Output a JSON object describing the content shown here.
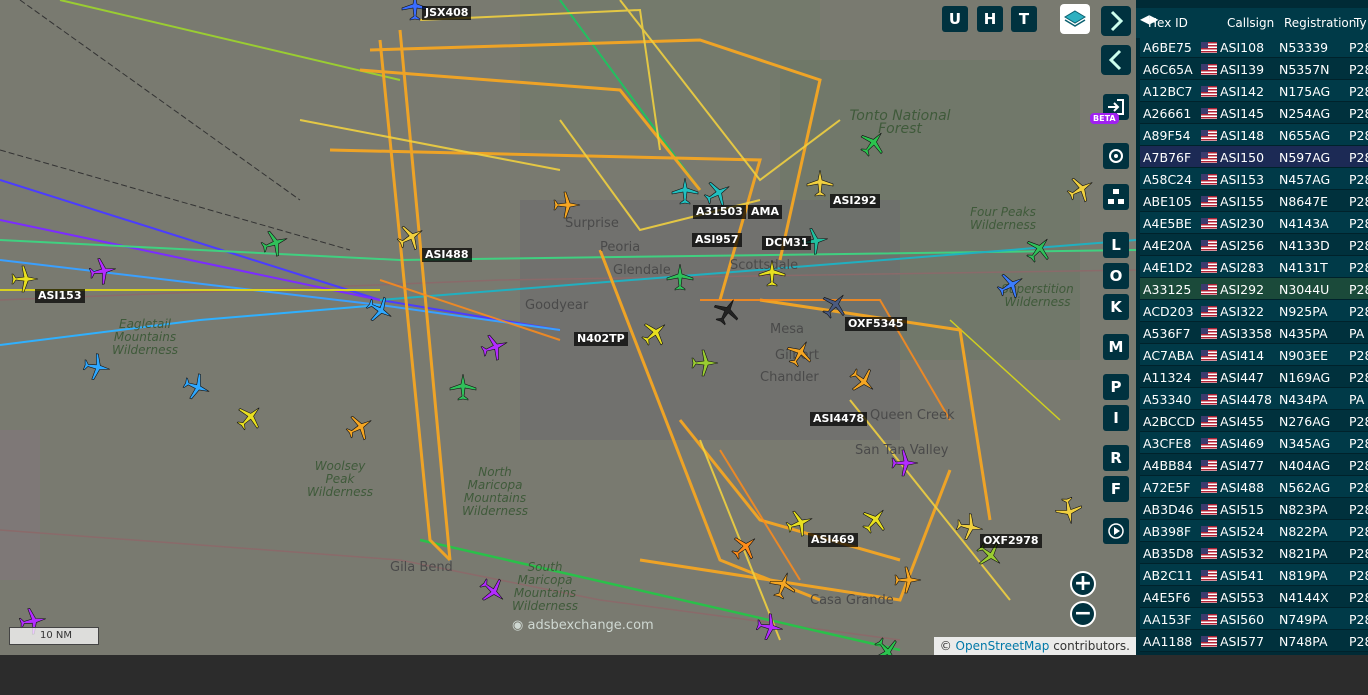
{
  "map": {
    "places": [
      {
        "name": "Tonto National Forest",
        "style": "green"
      },
      {
        "name": "Four Peaks Wilderness",
        "style": "green"
      },
      {
        "name": "Superstition Wilderness",
        "style": "green"
      },
      {
        "name": "Eagletail Mountains Wilderness",
        "style": "green"
      },
      {
        "name": "Woolsey Peak Wilderness",
        "style": "green"
      },
      {
        "name": "North Maricopa Mountains Wilderness",
        "style": "green"
      },
      {
        "name": "South Maricopa Mountains Wilderness",
        "style": "green"
      },
      {
        "name": "Surprise",
        "style": "city"
      },
      {
        "name": "Peoria",
        "style": "city"
      },
      {
        "name": "Glendale",
        "style": "city"
      },
      {
        "name": "Scottsdale",
        "style": "city"
      },
      {
        "name": "Goodyear",
        "style": "city"
      },
      {
        "name": "Mesa",
        "style": "city"
      },
      {
        "name": "Gilbert",
        "style": "city"
      },
      {
        "name": "Chandler",
        "style": "city"
      },
      {
        "name": "Queen Creek",
        "style": "city"
      },
      {
        "name": "San Tan Valley",
        "style": "city"
      },
      {
        "name": "Gila Bend",
        "style": "city"
      },
      {
        "name": "Casa Grande",
        "style": "city"
      }
    ],
    "labels": [
      "JSX408",
      "ASI292",
      "ASI488",
      "ASI153",
      "ASI957",
      "DCM31",
      "N402TP",
      "OXF5345",
      "ASI4478",
      "ASI469",
      "OXF2978",
      "A31503",
      "AMA"
    ],
    "watermark": "adsbexchange.com",
    "scale_text": "10 NM",
    "credit_prefix": "©",
    "credit_link": "OpenStreetMap",
    "credit_suffix": "contributors."
  },
  "toolbar": {
    "top_buttons": [
      "U",
      "H",
      "T"
    ],
    "side_buttons": [
      "L",
      "O",
      "K",
      "M",
      "P",
      "I",
      "R",
      "F"
    ],
    "beta_label": "BETA",
    "zoom_in": "+",
    "zoom_out": "−"
  },
  "table": {
    "columns": [
      "Hex ID",
      "Callsign",
      "Registration",
      "Ty"
    ],
    "rows": [
      {
        "hex": "A6BE75",
        "callsign": "ASI108",
        "reg": "N53339",
        "type": "P28"
      },
      {
        "hex": "A6C65A",
        "callsign": "ASI139",
        "reg": "N5357N",
        "type": "P28"
      },
      {
        "hex": "A12BC7",
        "callsign": "ASI142",
        "reg": "N175AG",
        "type": "P28"
      },
      {
        "hex": "A26661",
        "callsign": "ASI145",
        "reg": "N254AG",
        "type": "P28"
      },
      {
        "hex": "A89F54",
        "callsign": "ASI148",
        "reg": "N655AG",
        "type": "P28"
      },
      {
        "hex": "A7B76F",
        "callsign": "ASI150",
        "reg": "N597AG",
        "type": "P28"
      },
      {
        "hex": "A58C24",
        "callsign": "ASI153",
        "reg": "N457AG",
        "type": "P28"
      },
      {
        "hex": "ABE105",
        "callsign": "ASI155",
        "reg": "N8647E",
        "type": "P28"
      },
      {
        "hex": "A4E5BE",
        "callsign": "ASI230",
        "reg": "N4143A",
        "type": "P28"
      },
      {
        "hex": "A4E20A",
        "callsign": "ASI256",
        "reg": "N4133D",
        "type": "P28"
      },
      {
        "hex": "A4E1D2",
        "callsign": "ASI283",
        "reg": "N4131T",
        "type": "P28"
      },
      {
        "hex": "A33125",
        "callsign": "ASI292",
        "reg": "N3044U",
        "type": "P28"
      },
      {
        "hex": "ACD203",
        "callsign": "ASI322",
        "reg": "N925PA",
        "type": "P28"
      },
      {
        "hex": "A536F7",
        "callsign": "ASI3358",
        "reg": "N435PA",
        "type": "PA"
      },
      {
        "hex": "AC7ABA",
        "callsign": "ASI414",
        "reg": "N903EE",
        "type": "P28"
      },
      {
        "hex": "A11324",
        "callsign": "ASI447",
        "reg": "N169AG",
        "type": "P28"
      },
      {
        "hex": "A53340",
        "callsign": "ASI4478",
        "reg": "N434PA",
        "type": "PA"
      },
      {
        "hex": "A2BCCD",
        "callsign": "ASI455",
        "reg": "N276AG",
        "type": "P28"
      },
      {
        "hex": "A3CFE8",
        "callsign": "ASI469",
        "reg": "N345AG",
        "type": "P28"
      },
      {
        "hex": "A4BB84",
        "callsign": "ASI477",
        "reg": "N404AG",
        "type": "P28"
      },
      {
        "hex": "A72E5F",
        "callsign": "ASI488",
        "reg": "N562AG",
        "type": "P28"
      },
      {
        "hex": "AB3D46",
        "callsign": "ASI515",
        "reg": "N823PA",
        "type": "P28"
      },
      {
        "hex": "AB398F",
        "callsign": "ASI524",
        "reg": "N822PA",
        "type": "P28"
      },
      {
        "hex": "AB35D8",
        "callsign": "ASI532",
        "reg": "N821PA",
        "type": "P28"
      },
      {
        "hex": "AB2C11",
        "callsign": "ASI541",
        "reg": "N819PA",
        "type": "P28"
      },
      {
        "hex": "A4E5F6",
        "callsign": "ASI553",
        "reg": "N4144X",
        "type": "P28"
      },
      {
        "hex": "AA153F",
        "callsign": "ASI560",
        "reg": "N749PA",
        "type": "P28"
      },
      {
        "hex": "AA1188",
        "callsign": "ASI577",
        "reg": "N748PA",
        "type": "P28"
      }
    ],
    "selected_index": 5,
    "highlighted_index": 11
  }
}
